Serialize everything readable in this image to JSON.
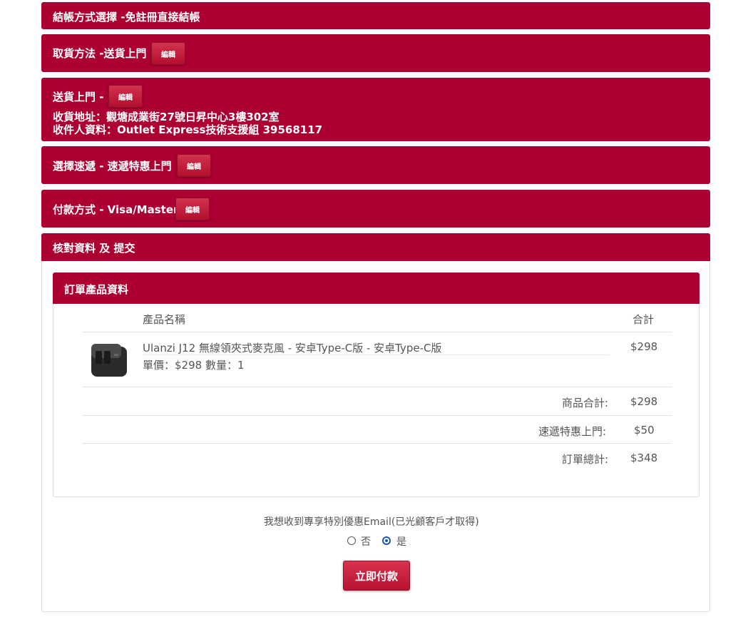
{
  "sections": {
    "checkout_method": "結帳方式選擇 -免註冊直接結帳",
    "pickup": "取貨方法 -送貨上門",
    "delivery": "送貨上門 -",
    "address": "收貨地址：觀塘成業街27號日昇中心3樓302室",
    "recipient": "收件人資料：Outlet Express技術支援組 39568117",
    "courier": "選擇速遞 - 速遞特惠上門",
    "payment": "付款方式 - Visa/Master",
    "review": "核對資料 及 提交"
  },
  "edit_label": "編輯",
  "order": {
    "title": "訂單產品資料",
    "col_name": "產品名稱",
    "col_total": "合計",
    "item": {
      "name": "Ulanzi J12 無線領夾式麥克風 - 安卓Type-C版 - 安卓Type-C版",
      "unit": "單價：$298 數量：1",
      "total": "$298"
    },
    "subtotal_label": "商品合計:",
    "subtotal": "$298",
    "shipping_label": "速遞特惠上門:",
    "shipping": "$50",
    "grand_label": "訂單總計:",
    "grand": "$348"
  },
  "email_opt": {
    "question": "我想收到專享特別優惠Email(已光顧客戶才取得)",
    "no": "否",
    "yes": "是",
    "selected": "是"
  },
  "pay_button": "立即付款",
  "colors": {
    "accent": "#ad0032",
    "radio": "#1a56b8"
  }
}
